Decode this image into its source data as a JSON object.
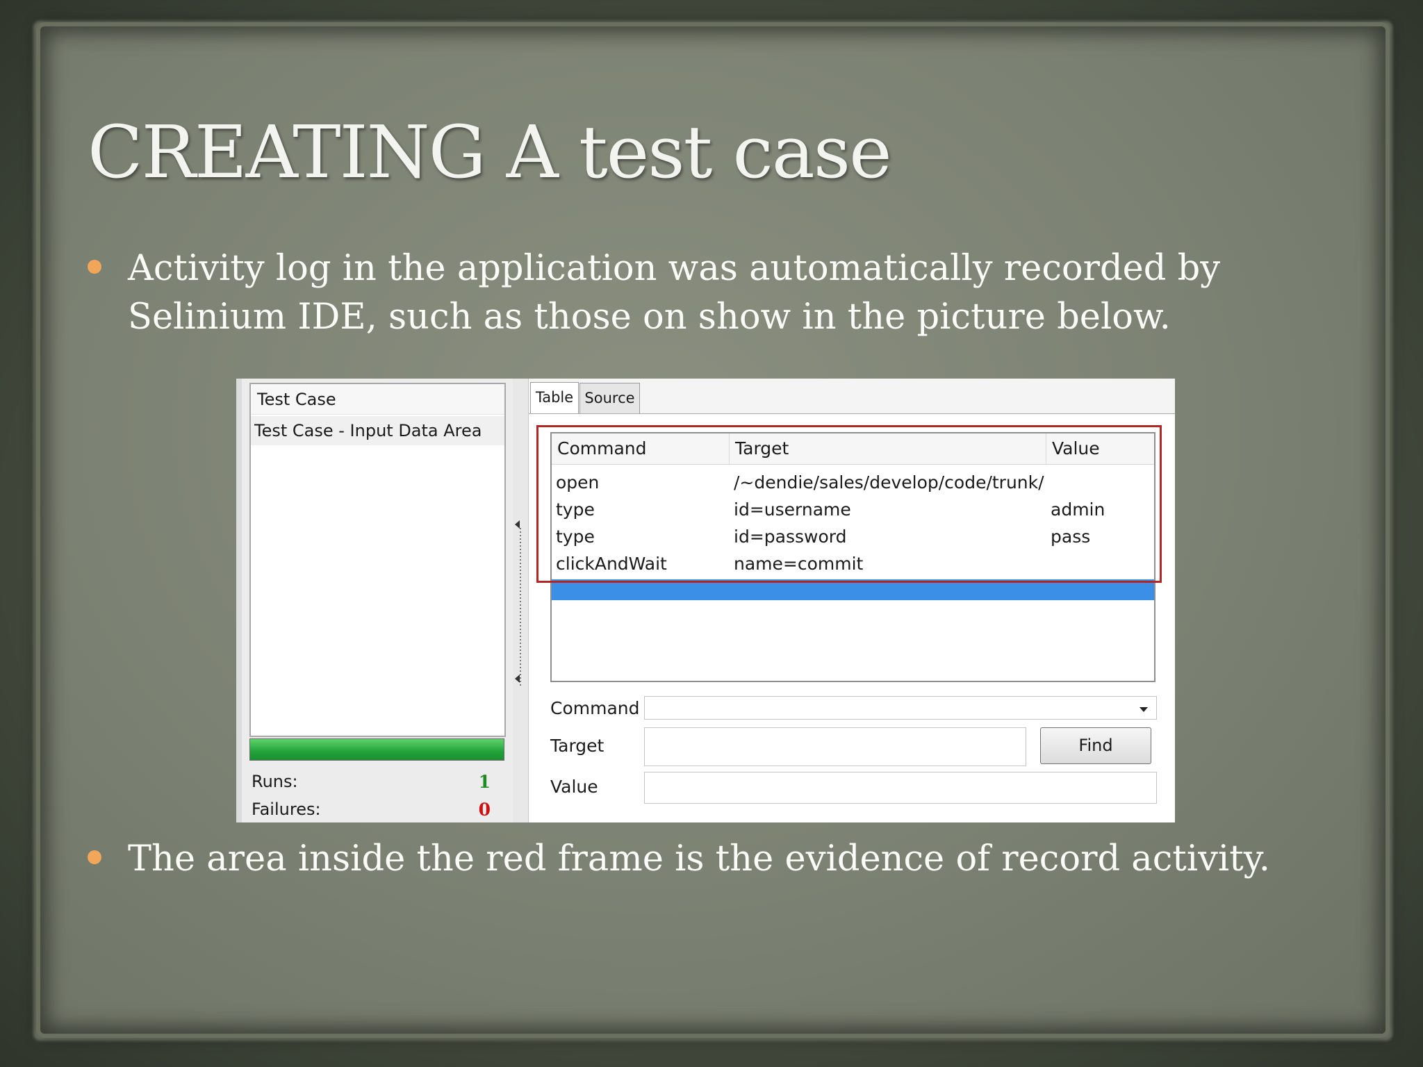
{
  "slide": {
    "title": "CREATING A test case",
    "bullets": [
      "Activity log in the application was automatically recorded by Selinium IDE, such as those on show in the picture below.",
      "The area inside the red frame is the evidence of record activity."
    ]
  },
  "ide": {
    "test_case_header": "Test Case",
    "test_case_item": "Test Case - Input Data Area",
    "runs_label": "Runs:",
    "runs_value": "1",
    "failures_label": "Failures:",
    "failures_value": "0",
    "tabs": [
      "Table",
      "Source"
    ],
    "columns": [
      "Command",
      "Target",
      "Value"
    ],
    "rows": [
      {
        "command": "open",
        "target": "/~dendie/sales/develop/code/trunk/",
        "value": ""
      },
      {
        "command": "type",
        "target": "id=username",
        "value": "admin"
      },
      {
        "command": "type",
        "target": "id=password",
        "value": "pass"
      },
      {
        "command": "clickAndWait",
        "target": "name=commit",
        "value": ""
      }
    ],
    "form": {
      "command_label": "Command",
      "target_label": "Target",
      "value_label": "Value",
      "command_value": "",
      "target_value": "",
      "value_value": "",
      "find_label": "Find"
    }
  },
  "colors": {
    "bullet": "#f2a65a",
    "highlight_frame": "#b32626",
    "selected_row": "#3b8fe6",
    "progress": "#22a23a"
  }
}
